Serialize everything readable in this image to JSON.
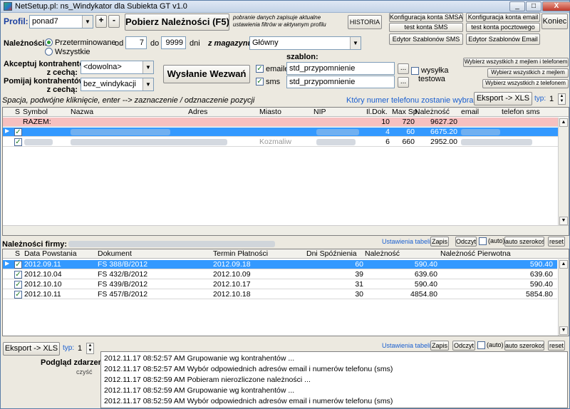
{
  "window": {
    "title": "NetSetup.pl: ns_Windykator dla Subiekta GT  v1.0",
    "min": "_",
    "max": "□",
    "close": "X"
  },
  "profile": {
    "label": "Profil:",
    "value": "ponad7",
    "plus": "+",
    "minus": "-"
  },
  "fetch_button": "Pobierz Należności (F5)",
  "fetch_note": "pobranie danych zapisuje aktualne ustawienia filtrów w aktywnym profilu",
  "historia": "HISTORIA",
  "config": {
    "smsapi": "Konfiguracja konta SMSAPI",
    "test_sms": "test konta SMS",
    "editor_sms": "Edytor Szablonów SMS",
    "email_cfg": "Konfiguracja konta email",
    "test_mail": "test konta pocztowego",
    "editor_email": "Edytor Szablonów Email",
    "koniec": "Koniec"
  },
  "naleznosci": {
    "label": "Należności:",
    "opt_overdue": "Przeterminowane",
    "opt_all": "Wszystkie",
    "od_label": "od",
    "od": "7",
    "do_label": "do",
    "do": "9999",
    "dni": "dni"
  },
  "magazyn": {
    "label": "z magazynu:",
    "value": "Główny"
  },
  "akceptuj": {
    "label1": "Akceptuj kontrahentów",
    "label2": "z cechą:",
    "value": "<dowolna>"
  },
  "pomijaj": {
    "label1": "Pomijaj kontrahentów",
    "label2": "z cechą:",
    "value": "bez_windykacji"
  },
  "send_button": "Wysłanie Wezwań",
  "szablon": {
    "label": "szablon:",
    "email_label": "emaile",
    "email_value": "std_przypomnienie",
    "sms_label": "sms",
    "sms_value": "std_przypomnienie",
    "dots": "...",
    "test_label1": "wysyłka",
    "test_label2": "testowa"
  },
  "select_buttons": [
    "Wybierz wszystkich z mejlem i telefonem",
    "Wybierz wszystkich z mejlem",
    "Wybierz wszystkich z telefonem"
  ],
  "hint": "Spacja, podwójne kliknięcie, enter --> zaznaczenie / odznaczenie pozycji",
  "which_phone": "Który numer telefonu zostanie wybrany ?",
  "export": {
    "label": "Eksport -> XLS",
    "typ_label": "typ:",
    "typ_value": "1"
  },
  "grid1": {
    "headers": [
      "S",
      "Symbol",
      "Nazwa",
      "Adres",
      "Miasto",
      "NIP",
      "Il.Dok.",
      "Max Sp.",
      "Należność",
      "email",
      "telefon sms"
    ],
    "rows": [
      {
        "s": "",
        "symbol": "RAZEM:",
        "nazwa": "",
        "adres": "",
        "miasto": "",
        "nip": "",
        "il": "10",
        "max": "720",
        "nal": "9627.20",
        "email": "",
        "tel": ""
      },
      {
        "s": "✓",
        "symbol": "",
        "nazwa": "",
        "adres": "",
        "miasto": "",
        "nip": "",
        "il": "4",
        "max": "60",
        "nal": "6675.20",
        "email": "",
        "tel": ""
      },
      {
        "s": "✓",
        "symbol": "",
        "nazwa": "",
        "adres": "",
        "miasto": "Kozmaliw",
        "nip": "",
        "il": "6",
        "max": "660",
        "nal": "2952.00",
        "email": "",
        "tel": ""
      }
    ]
  },
  "firm": {
    "label": "Należności firmy:",
    "settings": "Ustawienia tabeli",
    "zapis": "Zapis",
    "odczyt": "Odczyt",
    "auto": "(auto)",
    "autoszer": "auto szerokość",
    "reset": "reset"
  },
  "grid2": {
    "headers": [
      "S",
      "Data Powstania",
      "Dokument",
      "Termin Płatności",
      "Dni Spóźnienia",
      "Należność",
      "Należność Pierwotna"
    ],
    "rows": [
      {
        "s": "✓",
        "data": "2012.09.11",
        "dok": "FS 388/B/2012",
        "termin": "2012.09.18",
        "dni": "60",
        "nal": "590.40",
        "pierw": "590.40"
      },
      {
        "s": "✓",
        "data": "2012.10.04",
        "dok": "FS 432/B/2012",
        "termin": "2012.10.09",
        "dni": "39",
        "nal": "639.60",
        "pierw": "639.60"
      },
      {
        "s": "✓",
        "data": "2012.10.10",
        "dok": "FS 439/B/2012",
        "termin": "2012.10.17",
        "dni": "31",
        "nal": "590.40",
        "pierw": "590.40"
      },
      {
        "s": "✓",
        "data": "2012.10.11",
        "dok": "FS 457/B/2012",
        "termin": "2012.10.18",
        "dni": "30",
        "nal": "4854.80",
        "pierw": "5854.80"
      }
    ]
  },
  "events": {
    "label": "Podgląd zdarzeń:",
    "clear": "czyść",
    "lines": [
      "2012.11.17 08:52:57 AM  Grupowanie wg kontrahentów ...",
      "2012.11.17 08:52:57 AM  Wybór odpowiednich adresów email i numerów telefonu (sms)",
      "2012.11.17 08:52:59 AM  Pobieram nierozliczone należności ...",
      "2012.11.17 08:52:59 AM  Grupowanie wg kontrahentów ...",
      "2012.11.17 08:52:59 AM  Wybór odpowiednich adresów email i numerów telefonu (sms)"
    ]
  }
}
